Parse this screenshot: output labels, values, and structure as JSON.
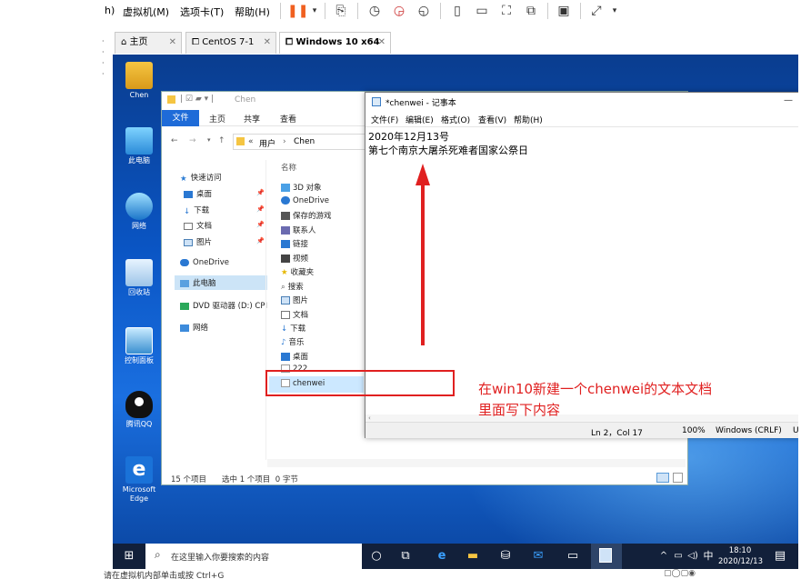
{
  "vm_menu": {
    "items": [
      "h)",
      "虚拟机(M)",
      "选项卡(T)",
      "帮助(H)"
    ]
  },
  "vm_tabs": [
    {
      "label": "主页",
      "icon": "home-icon"
    },
    {
      "label": "CentOS 7-1",
      "icon": "vm-icon"
    },
    {
      "label": "Windows 10 x64",
      "icon": "vm-icon"
    }
  ],
  "desktop_icons": [
    {
      "label": "Chen",
      "icon": "user-folder-icon"
    },
    {
      "label": "此电脑",
      "icon": "computer-icon"
    },
    {
      "label": "网络",
      "icon": "network-icon"
    },
    {
      "label": "回收站",
      "icon": "recycle-bin-icon"
    },
    {
      "label": "控制面板",
      "icon": "control-panel-icon"
    },
    {
      "label": "腾讯QQ",
      "icon": "qq-icon"
    },
    {
      "label": "Microsoft\nEdge",
      "icon": "edge-icon"
    }
  ],
  "explorer": {
    "title": "Chen",
    "ribbon": [
      "文件",
      "主页",
      "共享",
      "查看"
    ],
    "address": [
      "用户",
      "Chen"
    ],
    "nav": {
      "quick_access": "快速访问",
      "quick_items": [
        "桌面",
        "下载",
        "文档",
        "图片"
      ],
      "onedrive": "OneDrive",
      "this_pc": "此电脑",
      "dvd": "DVD 驱动器 (D:) CPI",
      "network": "网络"
    },
    "column_header": "名称",
    "files": [
      "3D 对象",
      "OneDrive",
      "保存的游戏",
      "联系人",
      "链接",
      "视频",
      "收藏夹",
      "搜索",
      "图片",
      "文档",
      "下载",
      "音乐",
      "桌面",
      "222",
      "chenwei"
    ],
    "status": {
      "count": "15 个项目",
      "selected": "选中 1 个项目  0 字节"
    }
  },
  "notepad": {
    "title": "*chenwei - 记事本",
    "menu": [
      "文件(F)",
      "编辑(E)",
      "格式(O)",
      "查看(V)",
      "帮助(H)"
    ],
    "lines": [
      "2020年12月13号",
      "第七个南京大屠杀死难者国家公祭日"
    ],
    "status": {
      "position": "Ln 2，Col 17",
      "zoom": "100%",
      "encoding": "Windows (CRLF)",
      "extra": "U"
    }
  },
  "taskbar": {
    "search_placeholder": "在这里输入你要搜索的内容",
    "time": "18:10",
    "date": "2020/12/13",
    "ime": "中"
  },
  "annotation": {
    "line1": "在win10新建一个chenwei的文本文档",
    "line2": "里面写下内容",
    "color": "#e02020"
  },
  "bottom_hint": "请在虚拟机内部单击或按 Ctrl+G"
}
